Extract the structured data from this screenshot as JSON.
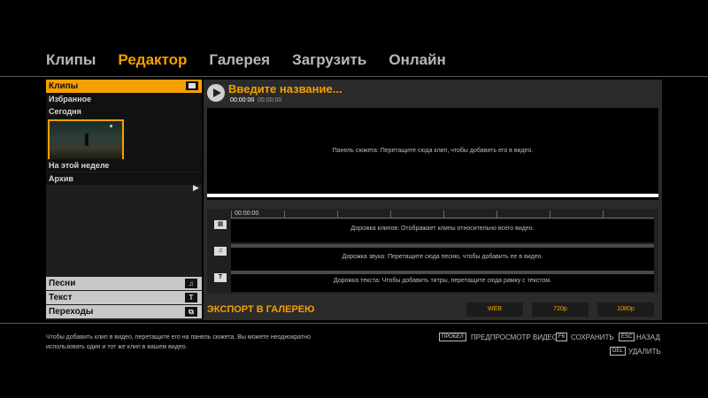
{
  "nav": {
    "tabs": [
      {
        "label": "Клипы"
      },
      {
        "label": "Редактор"
      },
      {
        "label": "Галерея"
      },
      {
        "label": "Загрузить"
      },
      {
        "label": "Онлайн"
      }
    ],
    "active": "Редактор"
  },
  "library": {
    "header": "Клипы",
    "sections": [
      "Избранное",
      "Сегодня",
      "На этой неделе",
      "Архив"
    ],
    "categories": [
      {
        "label": "Песни",
        "icon": "music-note-icon",
        "glyph": "♫"
      },
      {
        "label": "Текст",
        "icon": "text-icon",
        "glyph": "T"
      },
      {
        "label": "Переходы",
        "icon": "transition-icon",
        "glyph": "⧉"
      }
    ]
  },
  "editor": {
    "title_placeholder": "Введите название...",
    "time_current": "00:00:00",
    "time_separator": "/",
    "time_total": "00:00:00",
    "storyboard_hint": "Панель сюжета: Перетащите сюда клип, чтобы добавить его в видео.",
    "ruler_time": "00:00:00",
    "tracks": {
      "clips": "Дорожка клипов:  Отображает клипы относительно всего видео.",
      "audio": "Дорожка звука:  Перетащите сюда песню, чтобы добавить ее в видео.",
      "text": "Дорожка текста:  Чтобы добавить титры, перетащите сюда рамку с текстом."
    },
    "track_icons": {
      "audio_glyph": "♫",
      "text_glyph": "T"
    },
    "export_label": "ЭКСПОРТ В ГАЛЕРЕЮ",
    "export_options": [
      "WEB",
      "720p",
      "1080p"
    ]
  },
  "footer": {
    "help_text": "Чтобы добавить клип в видео, перетащите его на панель сюжета. Вы можете неоднократно использовать один и тот же клип в вашем видео.",
    "hints": [
      {
        "key": "ПРОБЕЛ",
        "label": "ПРЕДПРОСМОТР ВИДЕО"
      },
      {
        "key": "F6",
        "label": "СОХРАНИТЬ"
      },
      {
        "key": "ESC",
        "label": "НАЗАД"
      },
      {
        "key": "DEL",
        "label": "УДАЛИТЬ"
      }
    ]
  },
  "colors": {
    "accent": "#f5a000",
    "panel": "#2b2b2b",
    "background": "#000000"
  }
}
